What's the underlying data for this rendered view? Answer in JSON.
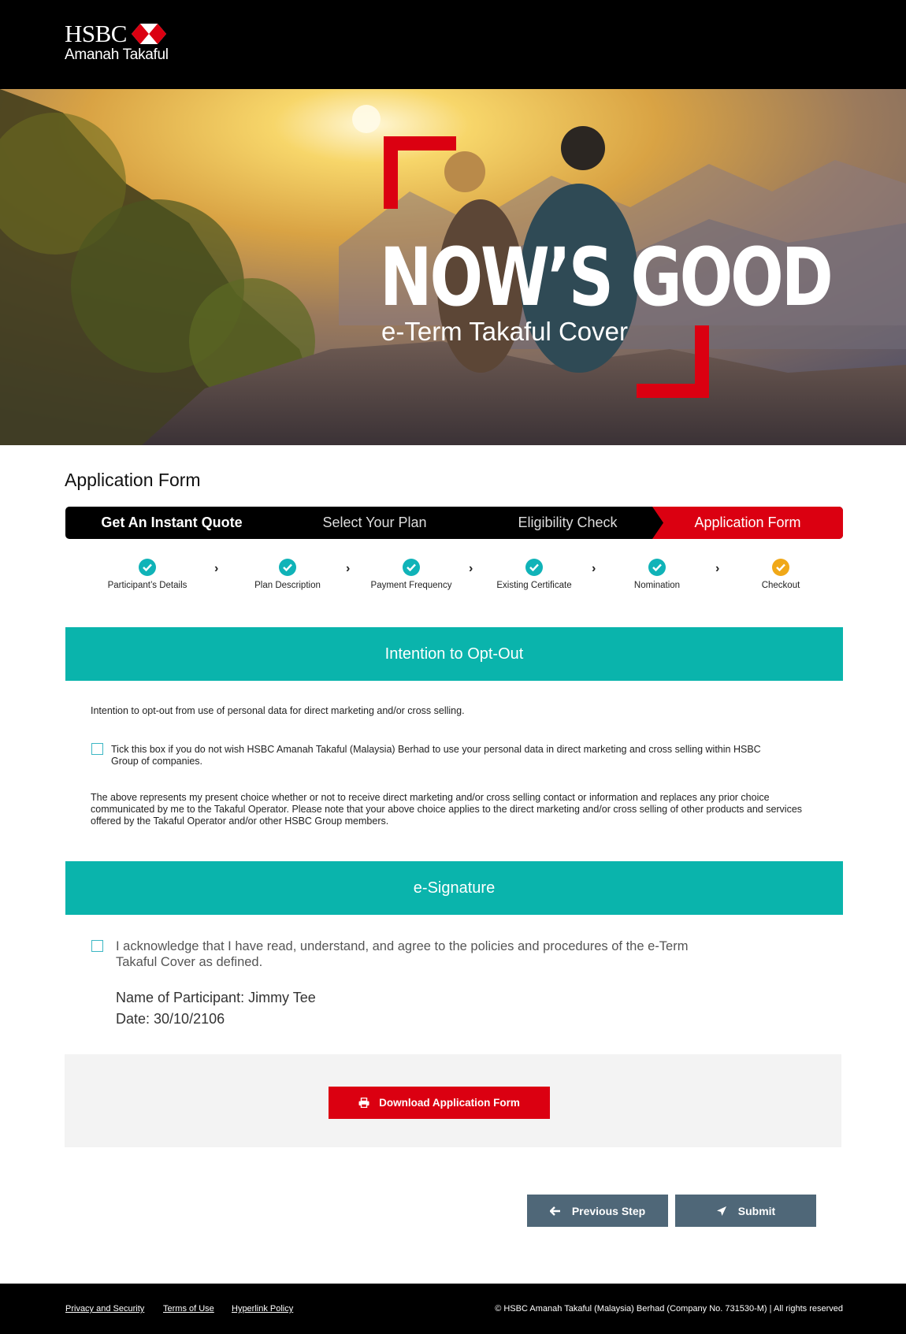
{
  "brand": {
    "name": "HSBC",
    "sub": "Amanah Takaful"
  },
  "hero": {
    "title": "NOW’S GOOD",
    "subtitle": "e-Term Takaful Cover"
  },
  "page_title": "Application Form",
  "steps": [
    {
      "label": "Get An Instant Quote"
    },
    {
      "label": "Select Your Plan"
    },
    {
      "label": "Eligibility Check"
    },
    {
      "label": "Application Form",
      "active": true
    }
  ],
  "substeps": [
    {
      "label": "Participant’s Details",
      "status": "done"
    },
    {
      "label": "Plan Description",
      "status": "done"
    },
    {
      "label": "Payment Frequency",
      "status": "done"
    },
    {
      "label": "Existing Certificate",
      "status": "done"
    },
    {
      "label": "Nomination",
      "status": "done"
    },
    {
      "label": "Checkout",
      "status": "current"
    }
  ],
  "optout": {
    "heading": "Intention to Opt-Out",
    "intro": "Intention to opt-out from use of personal data for direct marketing and/or cross selling.",
    "checkbox_label": "Tick this box if you do not wish HSBC Amanah Takaful (Malaysia) Berhad to use your personal data in direct marketing and cross selling within HSBC Group of companies.",
    "checked": false,
    "note": "The above represents my present choice whether or not to receive direct marketing and/or cross selling contact or information and replaces any prior choice communicated by me to the Takaful Operator. Please note that your above choice applies to the direct marketing and/or cross selling of other products and services offered by the Takaful Operator and/or other HSBC Group members."
  },
  "esignature": {
    "heading": "e-Signature",
    "ack_label": "I acknowledge that I have read, understand, and agree to the policies and procedures of the e-Term Takaful Cover as defined.",
    "checked": false,
    "participant_line": "Name of Participant: Jimmy Tee",
    "date_line": "Date: 30/10/2106"
  },
  "actions": {
    "download": "Download Application Form",
    "previous": "Previous Step",
    "submit": "Submit"
  },
  "footer": {
    "links": [
      "Privacy and Security",
      "Terms of Use",
      "Hyperlink Policy"
    ],
    "copyright": "© HSBC Amanah Takaful (Malaysia) Berhad (Company No. 731530-M) | All rights reserved"
  },
  "colors": {
    "brand_red": "#db0011",
    "teal": "#0ab4ac",
    "done_check": "#10b3b8",
    "current_check": "#f0a818",
    "nav_button": "#4f6778"
  }
}
